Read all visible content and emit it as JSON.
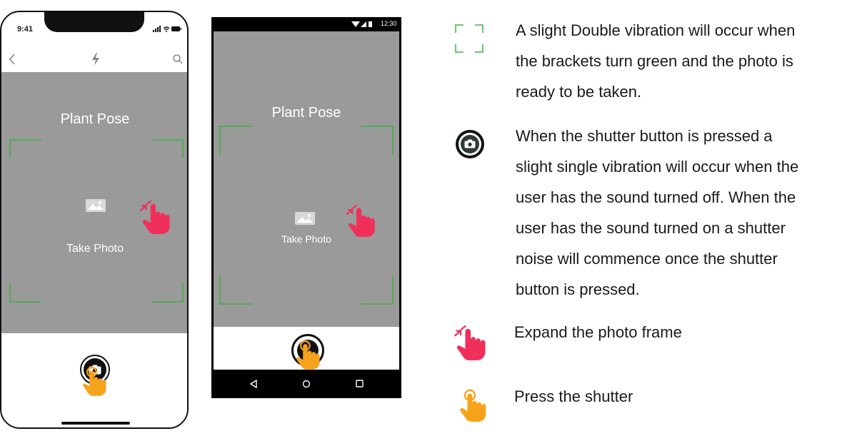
{
  "ios": {
    "time": "9:41",
    "pose_title": "Plant Pose",
    "take_photo": "Take Photo"
  },
  "android": {
    "time": "12:30",
    "pose_title": "Plant Pose",
    "take_photo": "Take Photo"
  },
  "legend": {
    "brackets": {
      "icon": "brackets-icon",
      "lines": [
        "A slight Double vibration will occur when",
        "the brackets turn green and the photo is",
        "ready to be taken."
      ]
    },
    "shutter": {
      "icon": "camera-shutter-icon",
      "lines": [
        "When the shutter button is pressed a",
        "slight single vibration will occur when the",
        "user has the sound turned off.  When the",
        "user has the sound turned on a shutter",
        "noise will commence once the shutter",
        "button is pressed."
      ]
    },
    "expand": {
      "icon": "pinch-expand-hand-icon",
      "text": "Expand the photo frame"
    },
    "press": {
      "icon": "tap-hand-icon",
      "text": "Press the shutter"
    }
  },
  "colors": {
    "camera_bg": "#9a9a9a",
    "bracket_green": "#3cb043",
    "gesture_pink": "#f0305a",
    "tap_orange": "#f7a21b"
  }
}
